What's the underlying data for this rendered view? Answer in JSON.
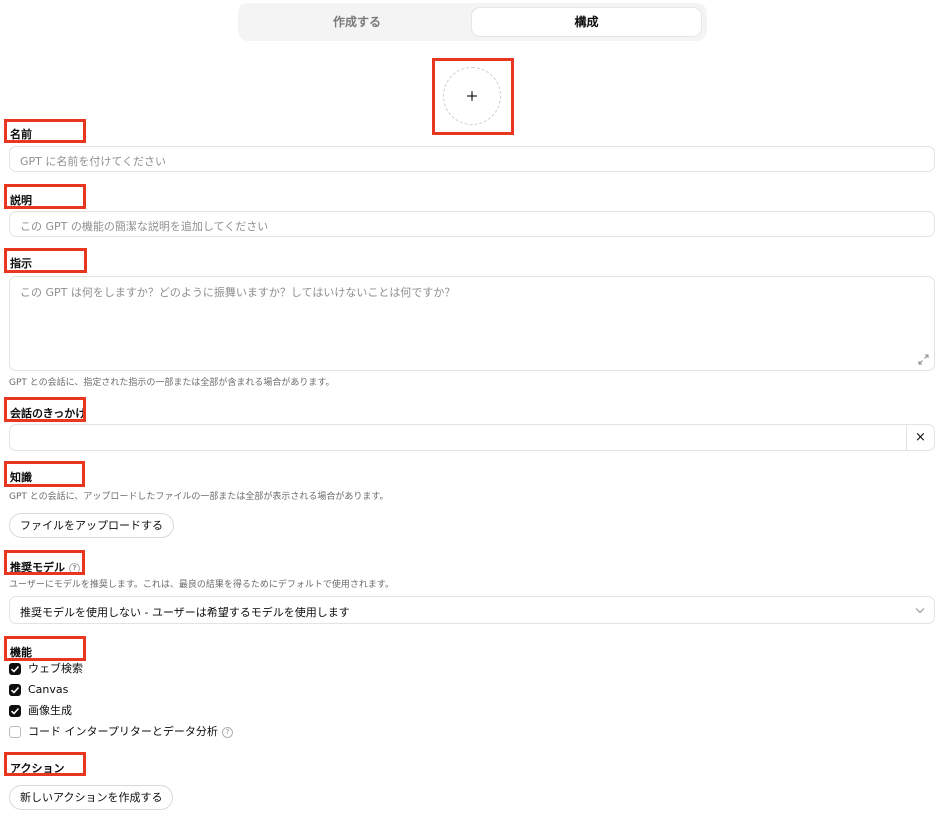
{
  "tabs": {
    "create": "作成する",
    "configure": "構成"
  },
  "name": {
    "label": "名前",
    "placeholder": "GPT に名前を付けてください"
  },
  "description": {
    "label": "説明",
    "placeholder": "この GPT の機能の簡潔な説明を追加してください"
  },
  "instructions": {
    "label": "指示",
    "placeholder": "この GPT は何をしますか？どのように振舞いますか？してはいけないことは何ですか？",
    "help": "GPT との会話に、指定された指示の一部または全部が含まれる場合があります。"
  },
  "starters": {
    "label": "会話のきっかけ",
    "value": "",
    "remove": "×"
  },
  "knowledge": {
    "label": "知識",
    "help": "GPT との会話に、アップロードしたファイルの一部または全部が表示される場合があります。",
    "upload_button": "ファイルをアップロードする"
  },
  "recommended_model": {
    "label": "推奨モデル",
    "help": "ユーザーにモデルを推奨します。これは、最良の結果を得るためにデフォルトで使用されます。",
    "selected": "推奨モデルを使用しない - ユーザーは希望するモデルを使用します"
  },
  "capabilities": {
    "label": "機能",
    "items": [
      {
        "label": "ウェブ検索",
        "checked": true
      },
      {
        "label": "Canvas",
        "checked": true
      },
      {
        "label": "画像生成",
        "checked": true
      },
      {
        "label": "コード インタープリターとデータ分析",
        "checked": false
      }
    ]
  },
  "actions": {
    "label": "アクション",
    "create_button": "新しいアクションを作成する"
  },
  "colors": {
    "highlight": "#e8371e",
    "text": "#0d0d0d",
    "placeholder": "#8f8f8f",
    "border": "#e3e3e3"
  }
}
